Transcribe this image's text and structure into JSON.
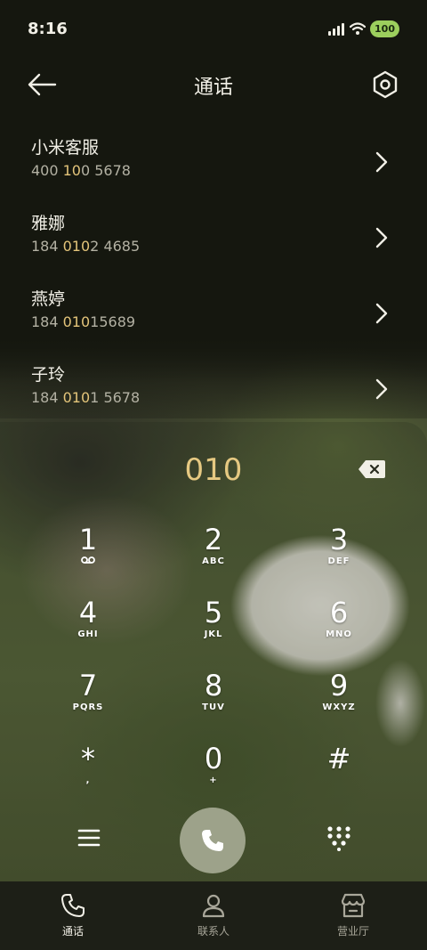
{
  "status_bar": {
    "time": "8:16",
    "battery": "100"
  },
  "header": {
    "title": "通话"
  },
  "contacts": [
    {
      "name": "小米客服",
      "num_pre": "400 ",
      "num_hl": "10",
      "num_post": "0 5678"
    },
    {
      "name": "雅娜",
      "num_pre": "184 ",
      "num_hl": "010",
      "num_post": "2 4685"
    },
    {
      "name": "燕婷",
      "num_pre": "184 ",
      "num_hl": "010",
      "num_post": "15689"
    },
    {
      "name": "子玲",
      "num_pre": "184 ",
      "num_hl": "010",
      "num_post": "1 5678"
    }
  ],
  "dialed_number": "010",
  "keypad": [
    {
      "digit": "1",
      "letters": ""
    },
    {
      "digit": "2",
      "letters": "ABC"
    },
    {
      "digit": "3",
      "letters": "DEF"
    },
    {
      "digit": "4",
      "letters": "GHI"
    },
    {
      "digit": "5",
      "letters": "JKL"
    },
    {
      "digit": "6",
      "letters": "MNO"
    },
    {
      "digit": "7",
      "letters": "PQRS"
    },
    {
      "digit": "8",
      "letters": "TUV"
    },
    {
      "digit": "9",
      "letters": "WXYZ"
    },
    {
      "digit": "*",
      "letters": ","
    },
    {
      "digit": "0",
      "letters": "+"
    },
    {
      "digit": "#",
      "letters": ""
    }
  ],
  "bottom_nav": [
    {
      "label": "通话",
      "icon": "phone-icon",
      "active": true
    },
    {
      "label": "联系人",
      "icon": "person-icon",
      "active": false
    },
    {
      "label": "营业厅",
      "icon": "store-icon",
      "active": false
    }
  ],
  "colors": {
    "highlight": "#e3c47a",
    "dialed": "#e6c982",
    "call_button": "#9da28a",
    "battery": "#9ccf5d"
  }
}
